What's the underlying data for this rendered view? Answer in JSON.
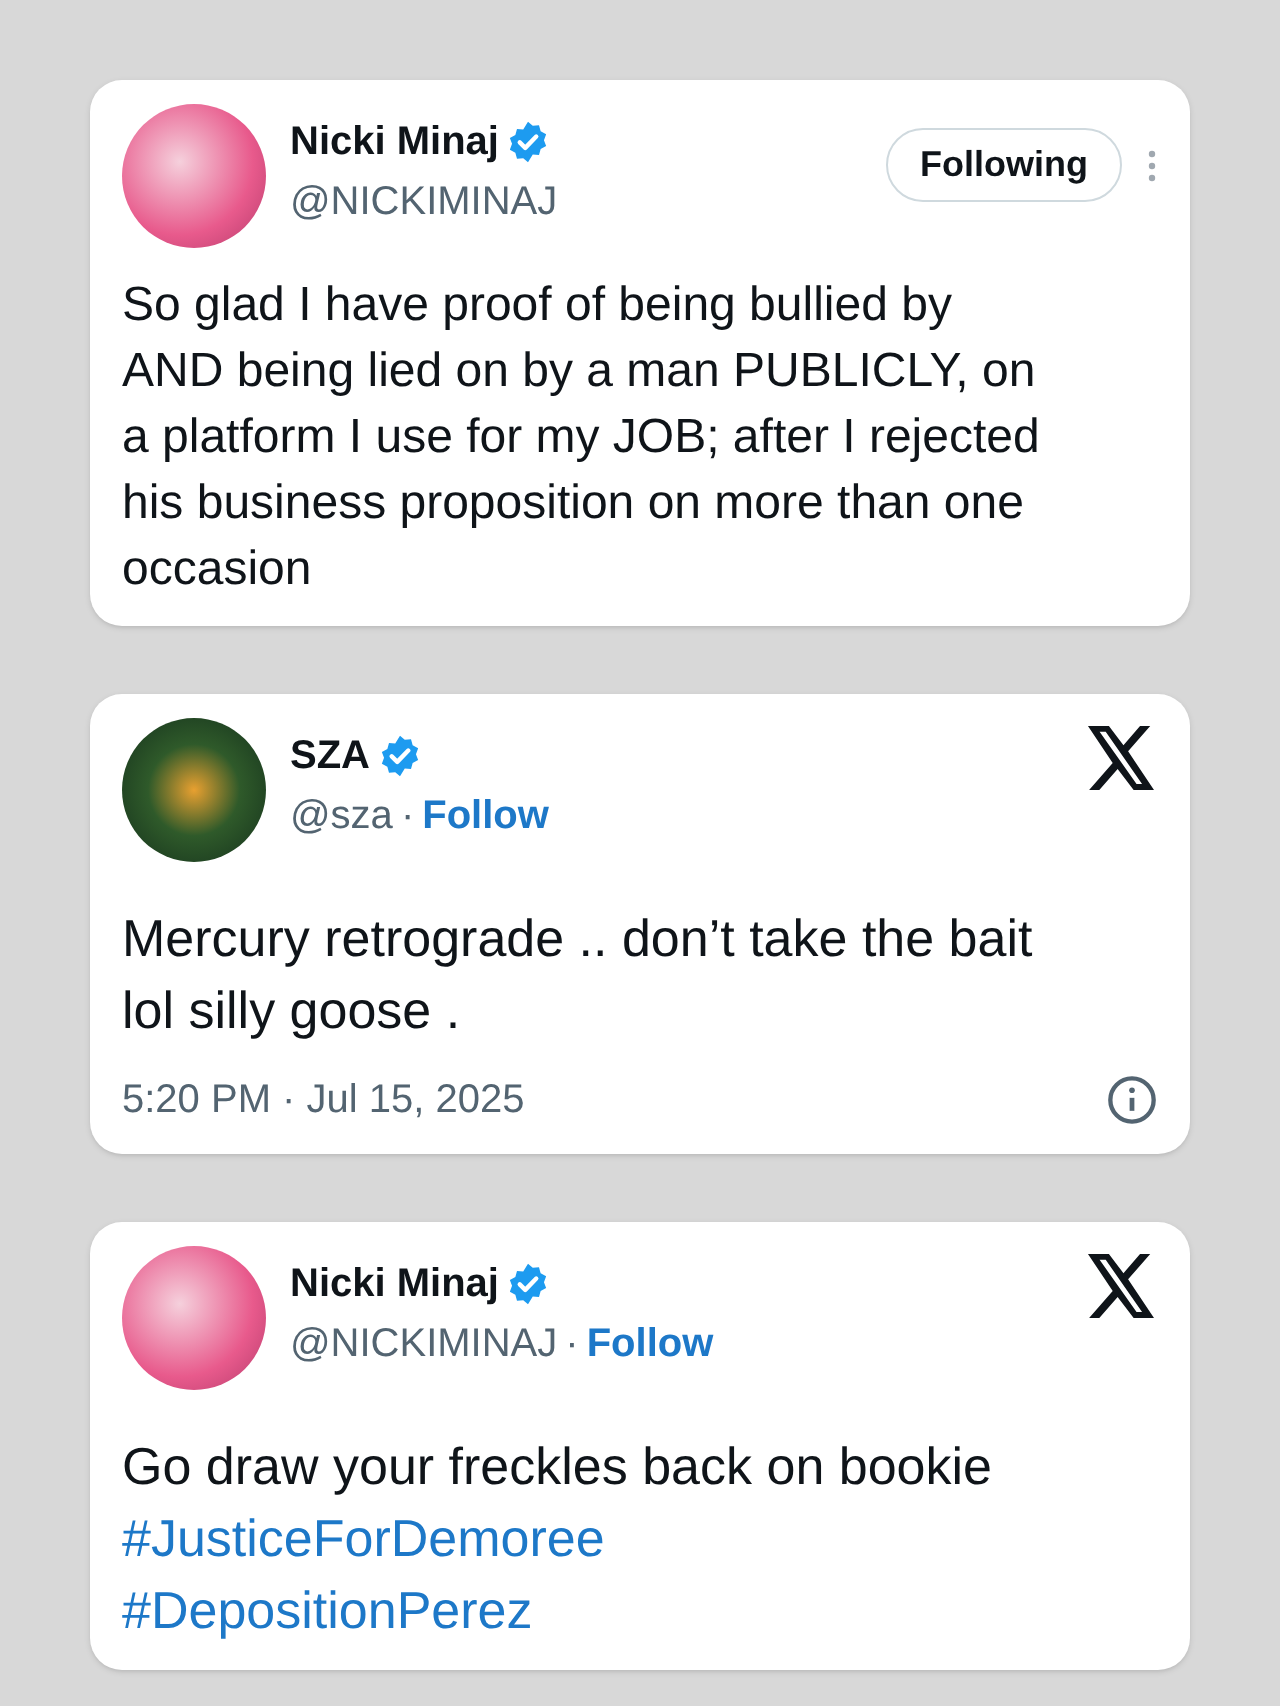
{
  "tweets": [
    {
      "name": "Nicki Minaj",
      "verified": true,
      "handle": "@NICKIMINAJ",
      "action": {
        "kind": "following-button",
        "label": "Following"
      },
      "text": "So glad I have proof of being bullied by AND being lied on by a man PUBLICLY, on a platform I use for my JOB; after I rejected his business proposition on more than one occasion"
    },
    {
      "name": "SZA",
      "verified": true,
      "handle": "@sza",
      "action": {
        "kind": "follow-link",
        "separator": "·",
        "label": "Follow"
      },
      "text": "Mercury retrograde .. don’t take the bait lol silly goose .",
      "timestamp": "5:20 PM · Jul 15, 2025"
    },
    {
      "name": "Nicki Minaj",
      "verified": true,
      "handle": "@NICKIMINAJ",
      "action": {
        "kind": "follow-link",
        "separator": "·",
        "label": "Follow"
      },
      "text": "Go draw your freckles back on bookie",
      "hashtags": [
        "#JusticeForDemoree",
        "#DepositionPerez"
      ]
    }
  ]
}
